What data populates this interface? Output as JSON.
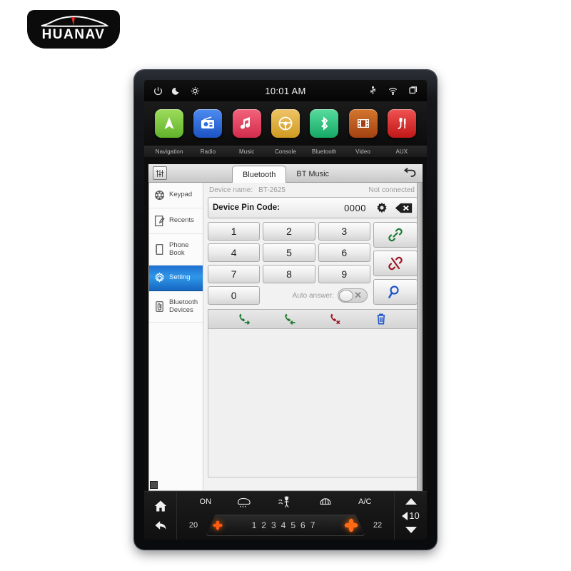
{
  "brand": {
    "name": "HUANAV",
    "logo_icon": "car-silhouette-icon"
  },
  "statusbar": {
    "time": "10:01 AM",
    "left_icons": [
      "power-icon",
      "moon-icon",
      "brightness-icon"
    ],
    "right_icons": [
      "usb-icon",
      "wifi-icon",
      "recent-apps-icon"
    ]
  },
  "apps": [
    {
      "label": "Navigation",
      "icon": "navigation-arrow-icon",
      "color": "#7ec742"
    },
    {
      "label": "Radio",
      "icon": "radio-icon",
      "color": "#2b6fe0"
    },
    {
      "label": "Music",
      "icon": "music-note-icon",
      "color": "#e8455f"
    },
    {
      "label": "Console",
      "icon": "steering-wheel-icon",
      "color": "#dfae3f"
    },
    {
      "label": "Bluetooth",
      "icon": "bluetooth-icon",
      "color": "#2cc07d"
    },
    {
      "label": "Video",
      "icon": "film-strip-icon",
      "color": "#c05a1d"
    },
    {
      "label": "AUX",
      "icon": "aux-plug-icon",
      "color": "#e02b2b"
    }
  ],
  "window": {
    "eq_icon": "equalizer-icon",
    "back_icon": "back-arrow-icon",
    "tabs": [
      {
        "label": "Bluetooth",
        "active": true
      },
      {
        "label": "BT Music",
        "active": false
      }
    ]
  },
  "sidebar": {
    "items": [
      {
        "label": "Keypad",
        "icon": "dialpad-icon",
        "active": false
      },
      {
        "label": "Recents",
        "icon": "recents-note-icon",
        "active": false
      },
      {
        "label": "Phone Book",
        "icon": "phonebook-icon",
        "active": false
      },
      {
        "label": "Setting",
        "icon": "gear-icon",
        "active": true
      },
      {
        "label": "Bluetooth Devices",
        "icon": "paperclip-icon",
        "active": false
      }
    ]
  },
  "device": {
    "name_label": "Device name:",
    "name_value": "BT-2625",
    "status": "Not connected",
    "pin_label": "Device Pin Code:",
    "pin_value": "0000",
    "pin_settings_icon": "gear-icon",
    "pin_backspace_icon": "backspace-icon"
  },
  "keypad": {
    "keys": [
      "1",
      "2",
      "3",
      "4",
      "5",
      "6",
      "7",
      "8",
      "9",
      "0"
    ],
    "auto_answer_label": "Auto answer:",
    "auto_answer_state": "off",
    "auto_answer_mark": "✕",
    "side_buttons": [
      {
        "icon": "link-connect-icon",
        "color": "#1d7a33"
      },
      {
        "icon": "link-break-disconnect-icon",
        "color": "#9b1622"
      },
      {
        "icon": "search-magnifier-icon",
        "color": "#2255c9"
      }
    ]
  },
  "call_toolbar": [
    {
      "icon": "outgoing-call-icon",
      "color": "#1d7a33"
    },
    {
      "icon": "incoming-call-icon",
      "color": "#1d7a33"
    },
    {
      "icon": "missed-call-icon",
      "color": "#9b1622"
    },
    {
      "icon": "trash-delete-icon",
      "color": "#2255c9"
    }
  ],
  "climate": {
    "nav_icons": [
      "home-icon",
      "back-arrow-icon"
    ],
    "power_label": "ON",
    "ac_label": "A/C",
    "icons": [
      "front-defrost-icon",
      "airflow-person-icon",
      "rear-defrost-icon"
    ],
    "temp_left": "20",
    "temp_right": "22",
    "fan_numbers": [
      "1",
      "2",
      "3",
      "4",
      "5",
      "6",
      "7"
    ],
    "fan_icon": "fan-leaf-icon",
    "volume_value": "10",
    "volume_up_icon": "triangle-up-icon",
    "volume_down_icon": "triangle-down-icon",
    "speaker_icon": "speaker-icon"
  }
}
